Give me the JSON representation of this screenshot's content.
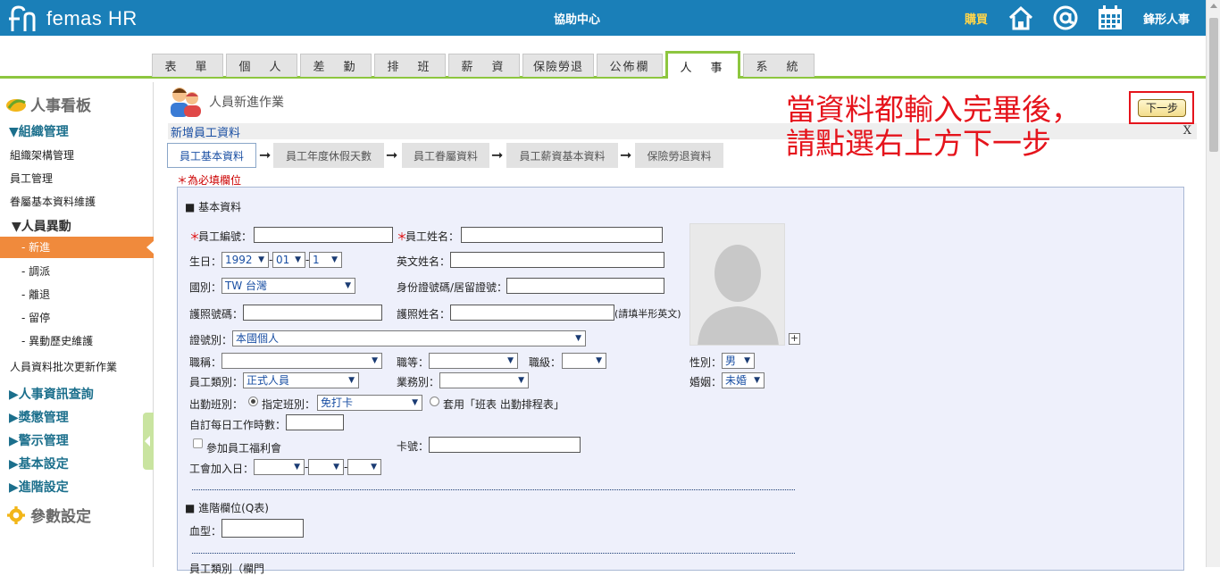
{
  "header": {
    "logo_text": "femas HR",
    "title": "協助中心",
    "buy_label": "購買",
    "user_name": "鋒形人事",
    "icons": [
      "home-icon",
      "at-icon",
      "calendar-icon"
    ]
  },
  "tabs": [
    {
      "label": "表　單",
      "active": false
    },
    {
      "label": "個　人",
      "active": false
    },
    {
      "label": "差　勤",
      "active": false
    },
    {
      "label": "排　班",
      "active": false
    },
    {
      "label": "薪　資",
      "active": false
    },
    {
      "label": "保險勞退",
      "active": false
    },
    {
      "label": "公佈欄",
      "active": false
    },
    {
      "label": "人　事",
      "active": true
    },
    {
      "label": "系　統",
      "active": false
    }
  ],
  "sidebar": {
    "board_title": "人事看板",
    "org_section": "▼組織管理",
    "org_items": [
      "組織架構管理",
      "員工管理",
      "眷屬基本資料維護"
    ],
    "change_section": "▼人員異動",
    "change_items": [
      "- 新進",
      "- 調派",
      "- 離退",
      "- 留停",
      "- 異動歷史維護"
    ],
    "batch_item": "人員資料批次更新作業",
    "sections": [
      "▶人事資訊查詢",
      "▶獎懲管理",
      "▶警示管理",
      "▶基本設定",
      "▶進階設定"
    ],
    "param_title": "參數設定"
  },
  "page": {
    "title": "人員新進作業",
    "sub_title": "新增員工資料",
    "close_label": "X",
    "steps": [
      "員工基本資料",
      "員工年度休假天數",
      "員工眷屬資料",
      "員工薪資基本資料",
      "保險勞退資料"
    ],
    "required_note": "＊為必填欄位",
    "next_label": "下一步",
    "annotation_line1": "當資料都輸入完畢後，",
    "annotation_line2": "請點選右上方下一步"
  },
  "form": {
    "basic_title": "■ 基本資料",
    "emp_no_label": "員工編號：",
    "emp_name_label": "員工姓名：",
    "req_mark": "＊",
    "birth_label": "生日：",
    "birth_year": "1992",
    "birth_month": "01",
    "birth_day": "1",
    "date_sep": "-",
    "eng_name_label": "英文姓名：",
    "country_label": "國別：",
    "country_value": "TW 台灣",
    "id_label": "身份證號碼/居留證號：",
    "passport_no_label": "護照號碼：",
    "passport_name_label": "護照姓名：",
    "passport_hint": "(請填半形英文)",
    "id_type_label": "證號別：",
    "id_type_value": "本國個人",
    "job_title_label": "職稱：",
    "grade_label": "職等：",
    "level_label": "職級：",
    "gender_label": "性別：",
    "gender_value": "男",
    "emp_type_label": "員工類別：",
    "emp_type_value": "正式人員",
    "business_label": "業務別：",
    "marriage_label": "婚姻：",
    "marriage_value": "未婚",
    "shift_label": "出勤班別：",
    "shift_opt1": "指定班別：",
    "shift_value": "免打卡",
    "shift_opt2": "套用「班表 出勤排程表」",
    "daily_hours_label": "自訂每日工作時數：",
    "welfare_label": "參加員工福利會",
    "card_label": "卡號：",
    "union_label": "工會加入日：",
    "advanced_title": "■ 進階欄位(Q表)",
    "blood_label": "血型：",
    "next_section_label": "員工類別（欄門"
  }
}
